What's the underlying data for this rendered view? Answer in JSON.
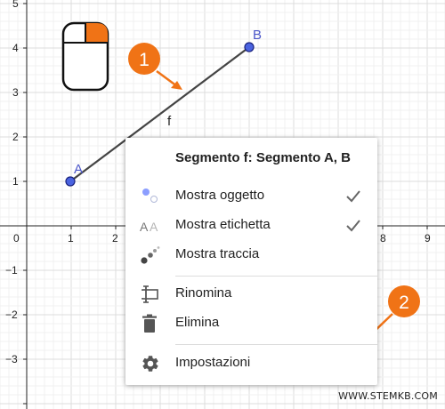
{
  "menu": {
    "title": "Segmento f: Segmento A, B",
    "items": [
      {
        "label": "Mostra oggetto",
        "checked": true
      },
      {
        "label": "Mostra etichetta",
        "checked": true
      },
      {
        "label": "Mostra traccia",
        "checked": false
      },
      {
        "label": "Rinomina"
      },
      {
        "label": "Elimina"
      },
      {
        "label": "Impostazioni"
      }
    ]
  },
  "graph": {
    "x_ticks": [
      "1",
      "2",
      "8",
      "9"
    ],
    "x_zero": "0",
    "y_ticks": [
      "5",
      "4",
      "3",
      "2",
      "1",
      "−1",
      "−2",
      "−3"
    ],
    "point_a": {
      "label": "A",
      "x": 1,
      "y": 1
    },
    "point_b": {
      "label": "B",
      "x": 5,
      "y": 4
    },
    "segment_label": "f"
  },
  "callouts": [
    {
      "number": "1"
    },
    {
      "number": "2"
    }
  ],
  "watermark": "WWW.STEMKB.COM",
  "colors": {
    "accent_orange": "#f07316",
    "point_blue": "#3b5bdb",
    "label_blue": "#4b56c9",
    "segment": "#444444",
    "grid_major": "#dddddd",
    "grid_minor": "#f0f0f0"
  }
}
